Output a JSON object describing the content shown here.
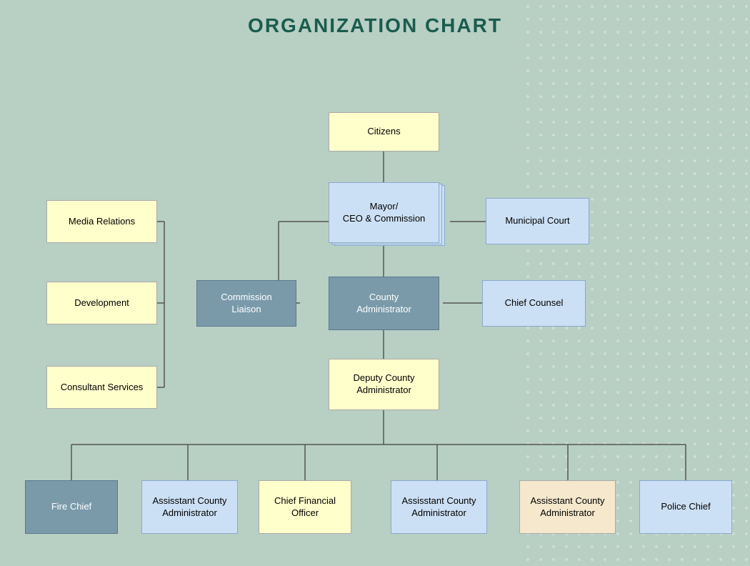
{
  "title": "ORGANIZATION CHART",
  "nodes": {
    "citizens": {
      "label": "Citizens"
    },
    "mayor": {
      "label": "Mayor/\nCEO & Commission"
    },
    "municipal_court": {
      "label": "Municipal Court"
    },
    "media_relations": {
      "label": "Media Relations"
    },
    "development": {
      "label": "Development"
    },
    "consultant_services": {
      "label": "Consultant Services"
    },
    "commission_liaison": {
      "label": "Commission\nLiaison"
    },
    "county_admin": {
      "label": "County\nAdministrator"
    },
    "chief_counsel": {
      "label": "Chief Counsel"
    },
    "deputy_county_admin": {
      "label": "Deputy County\nAdministrator"
    },
    "fire_chief": {
      "label": "Fire Chief"
    },
    "asst_admin_1": {
      "label": "Assisstant County\nAdministrator"
    },
    "cfo": {
      "label": "Chief Financial\nOfficer"
    },
    "asst_admin_2": {
      "label": "Assisstant County\nAdministrator"
    },
    "asst_admin_3": {
      "label": "Assisstant County\nAdministrator"
    },
    "police_chief": {
      "label": "Police Chief"
    }
  }
}
